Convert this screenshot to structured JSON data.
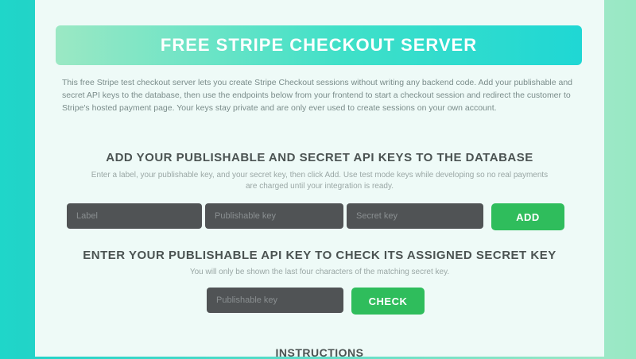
{
  "banner": {
    "title": "FREE STRIPE CHECKOUT SERVER"
  },
  "intro": {
    "text": "This free Stripe test checkout server lets you create Stripe Checkout sessions without writing any backend code. Add your publishable and secret API keys to the database, then use the endpoints below from your frontend to start a checkout session and redirect the customer to Stripe's hosted payment page. Your keys stay private and are only ever used to create sessions on your own account."
  },
  "add_keys": {
    "title": "ADD YOUR PUBLISHABLE AND SECRET API KEYS TO THE DATABASE",
    "subtitle": "Enter a label, your publishable key, and your secret key, then click Add. Use test mode keys while developing so no real payments are charged until your integration is ready.",
    "label_placeholder": "Label",
    "publishable_placeholder": "Publishable key",
    "secret_placeholder": "Secret key",
    "button_label": "ADD"
  },
  "check_key": {
    "title": "ENTER YOUR PUBLISHABLE API KEY TO CHECK ITS ASSIGNED SECRET KEY",
    "subtitle": "You will only be shown the last four characters of the matching secret key.",
    "publishable_placeholder": "Publishable key",
    "button_label": "CHECK"
  },
  "instructions": {
    "title": "INSTRUCTIONS"
  },
  "colors": {
    "accent_green": "#2fbd5c",
    "banner_start": "#9be8c4",
    "banner_end": "#1fd7d4",
    "input_bg": "#505355",
    "side_left": "#1fd6c9",
    "side_right": "#98e8c4"
  }
}
